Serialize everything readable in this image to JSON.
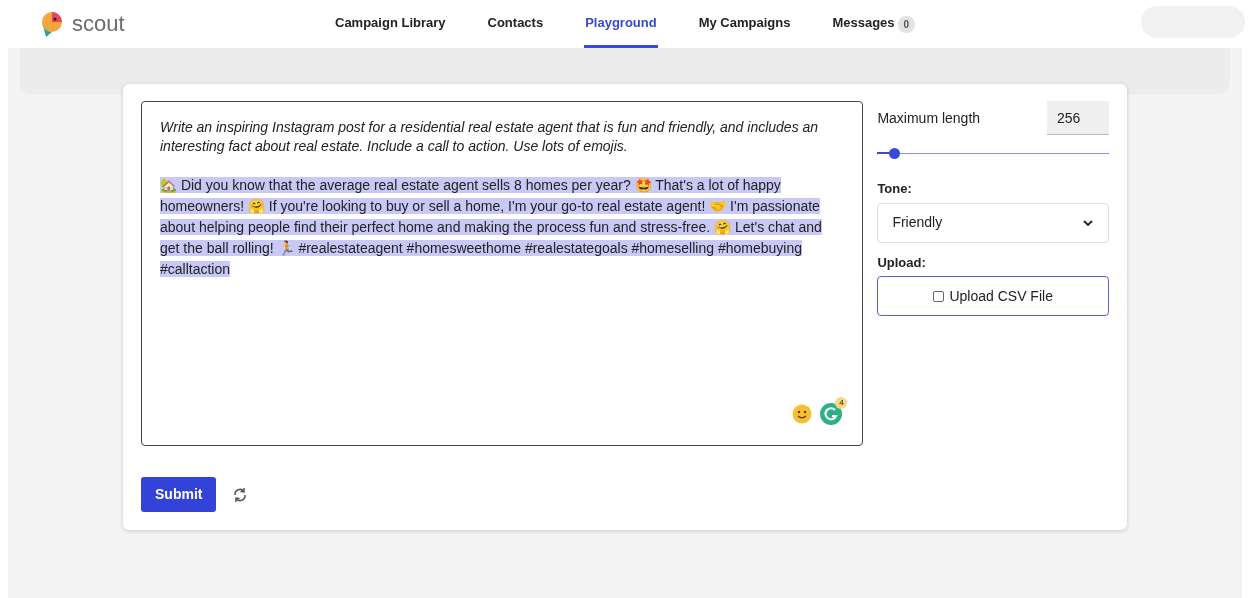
{
  "brand": {
    "name": "scout"
  },
  "nav": [
    {
      "label": "Campaign Library",
      "selected": false
    },
    {
      "label": "Contacts",
      "selected": false
    },
    {
      "label": "Playground",
      "selected": true
    },
    {
      "label": "My Campaigns",
      "selected": false
    },
    {
      "label": "Messages",
      "selected": false,
      "badge": "0"
    }
  ],
  "editor": {
    "prompt": "Write an inspiring Instagram post for a residential real estate agent that is fun and friendly, and includes an interesting fact about real estate. Include a call to action. Use lots of emojis.",
    "output": "🏡 Did you know that the average real estate agent sells 8 homes per year? 🤩 That's a lot of happy homeowners! 🤗 If you're looking to buy or sell a home, I'm your go-to real estate agent! 🤝 I'm passionate about helping people find their perfect home and making the process fun and stress-free. 🤗 Let's chat and get the ball rolling! 🏃 #realestateagent #homesweethome #realestategoals #homeselling #homebuying #calltaction",
    "output_highlighted": true,
    "grammar_badge": "4"
  },
  "settings": {
    "max_length_label": "Maximum length",
    "max_length_value": "256",
    "level": 0.07,
    "tone_label": "Tone:",
    "tone_value": "Friendly",
    "upload_label": "Upload:",
    "upload_button": "Upload CSV File",
    "upload_checked": false
  },
  "actions": {
    "submit": "Submit"
  }
}
